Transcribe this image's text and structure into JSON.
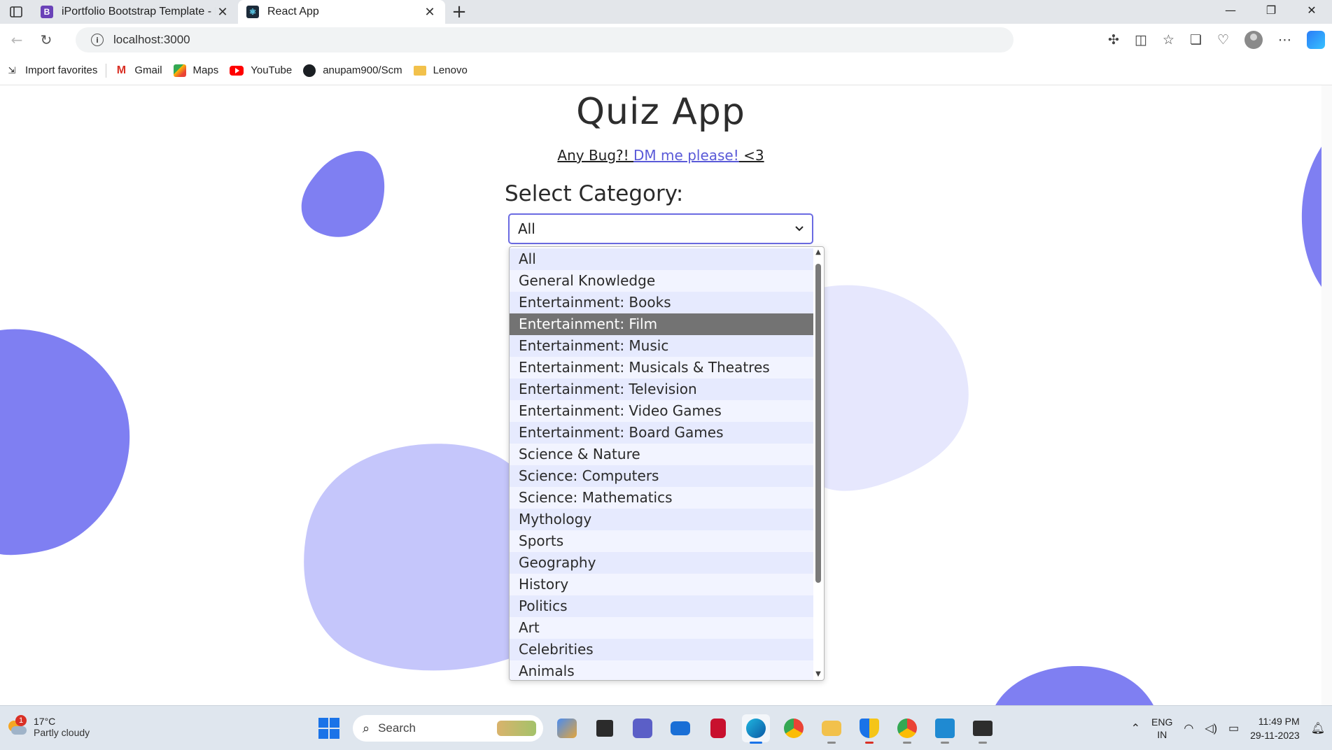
{
  "browser": {
    "tabs": [
      {
        "title": "iPortfolio Bootstrap Template - Ir",
        "active": false
      },
      {
        "title": "React App",
        "active": true
      }
    ],
    "url": "localhost:3000",
    "favorites": [
      {
        "label": "Import favorites",
        "icon": "import-icon"
      },
      {
        "label": "Gmail",
        "icon": "gmail-icon"
      },
      {
        "label": "Maps",
        "icon": "maps-icon"
      },
      {
        "label": "YouTube",
        "icon": "youtube-icon"
      },
      {
        "label": "anupam900/Scm",
        "icon": "github-icon"
      },
      {
        "label": "Lenovo",
        "icon": "folder-icon"
      }
    ]
  },
  "app": {
    "title": "Quiz App",
    "bug_prefix": "Any Bug?! ",
    "bug_link": "DM me please!",
    "bug_suffix": " <3",
    "category_label": "Select Category:",
    "selected_value": "All",
    "highlighted_option": "Entertainment: Film",
    "options": [
      "All",
      "General Knowledge",
      "Entertainment: Books",
      "Entertainment: Film",
      "Entertainment: Music",
      "Entertainment: Musicals & Theatres",
      "Entertainment: Television",
      "Entertainment: Video Games",
      "Entertainment: Board Games",
      "Science & Nature",
      "Science: Computers",
      "Science: Mathematics",
      "Mythology",
      "Sports",
      "Geography",
      "History",
      "Politics",
      "Art",
      "Celebrities",
      "Animals"
    ],
    "colors": {
      "accent": "#6b6be2",
      "blob_dark": "#7f7ff2",
      "blob_mid": "#c5c6fb",
      "blob_light": "#e6e7fd"
    }
  },
  "taskbar": {
    "weather_temp": "17°C",
    "weather_cond": "Partly cloudy",
    "weather_badge": "1",
    "search_placeholder": "Search",
    "lang_top": "ENG",
    "lang_bottom": "IN",
    "time": "11:49 PM",
    "date": "29-11-2023"
  }
}
